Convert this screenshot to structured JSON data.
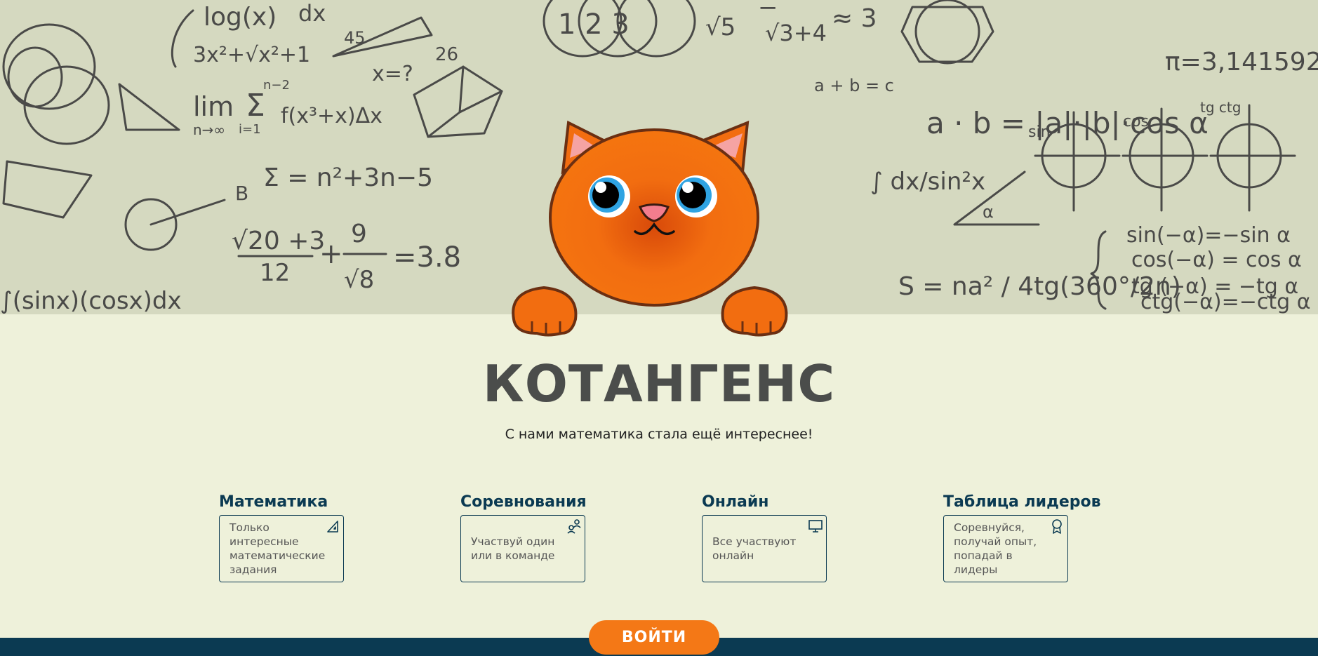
{
  "site": {
    "title": "КОТАНГЕНС",
    "tagline": "С нами математика стала ещё интереснее!"
  },
  "features": [
    {
      "title": "Математика",
      "text": "Только интересные математические задания",
      "icon": "triangle-ruler-icon"
    },
    {
      "title": "Соревнования",
      "text": "Участвуй один или в команде",
      "icon": "users-icon"
    },
    {
      "title": "Онлайн",
      "text": "Все участвуют онлайн",
      "icon": "monitor-icon"
    },
    {
      "title": "Таблица лидеров",
      "text": "Соревнуйся, получай опыт, попадай в лидеры",
      "icon": "award-icon"
    }
  ],
  "actions": {
    "login_label": "ВОЙТИ"
  },
  "hero_formulas": {
    "log": "log(x)",
    "dx1": "dx",
    "poly": "3x²+√x²+1",
    "lim": "lim",
    "lim_sub": "n→∞",
    "sum_top": "n−2",
    "sum_sub": "i=1",
    "sum_body": "f(x³+x)Δx",
    "sigma": "Σ = n²+3n−5",
    "frac1_num": "√20 +3",
    "frac1_den": "12",
    "plus": "+",
    "frac2_num": "9",
    "frac2_den": "√8",
    "eq38": "=3.8",
    "integral_bottom": "∫(sinx)(cosx)dx",
    "xq": "x=?",
    "n26": "26",
    "tri_45": "45",
    "approx": "≈ 3",
    "sqrt5": "√5",
    "sqrt3": "√3+4",
    "minus": "−",
    "a_b_c": "a + b = c",
    "dot": "a · b = |a|·|b|·cos α",
    "pi": "π=3,141592",
    "sin": "sin",
    "cos": "cos",
    "tgctg": "tg ctg",
    "int_dx": "∫ dx/sin²x",
    "S": "S = na² / 4tg(360°/2n)",
    "id1": "sin(−α)=−sin α",
    "id2": "cos(−α) = cos α",
    "id3": "tg (−α) = −tg α",
    "id4": "ctg(−α)=−ctg α",
    "circ_labels": "1 2 3",
    "angle": "α"
  },
  "colors": {
    "accent": "#f47816",
    "primary": "#0b3a52",
    "hero_bg": "#d5d9c0",
    "page_bg": "#eef1da",
    "title": "#4b4d4b"
  }
}
